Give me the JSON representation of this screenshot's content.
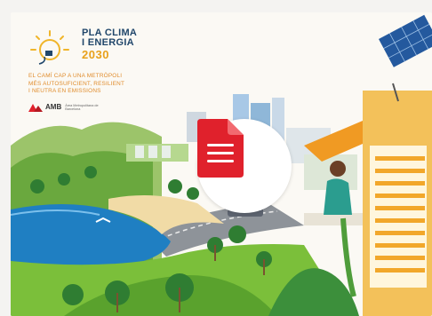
{
  "cover": {
    "title_line1": "PLA CLIMA",
    "title_line2": "I ENERGIA",
    "title_year": "2030",
    "tagline_1": "EL CAMÍ CAP A UNA METRÒPOLI",
    "tagline_2": "MÉS AUTOSUFICIENT, RESILIENT",
    "tagline_3": "I NEUTRA EN EMISSIONS",
    "amb_label": "AMB",
    "amb_sub": "Àrea Metropolitana de Barcelona"
  },
  "document_button": {
    "icon": "document-icon"
  },
  "colors": {
    "background": "#fbf9f4",
    "title_blue": "#21476b",
    "accent_orange": "#e8a11c",
    "doc_red": "#e0212c",
    "water_blue": "#1f7fc2",
    "grass_green": "#7bbf3a"
  }
}
